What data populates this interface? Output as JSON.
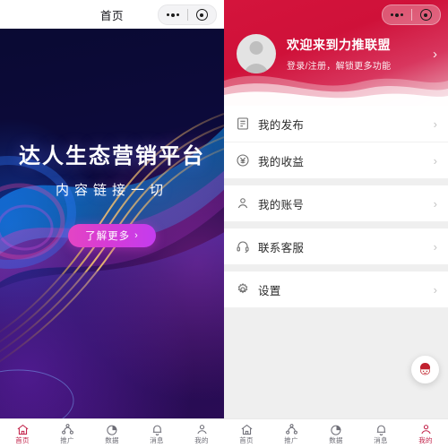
{
  "left_screen": {
    "nav": {
      "title": "首页",
      "capsule": {
        "more_icon": "more-dots-icon",
        "target_icon": "target-circle-icon"
      }
    },
    "hero": {
      "title": "达人生态营销平台",
      "subtitle": "内容链接一切",
      "cta_label": "了解更多",
      "cta_chevron": "›"
    },
    "tabbar": {
      "items": [
        {
          "label": "首页",
          "icon": "home-icon",
          "active": true
        },
        {
          "label": "推广",
          "icon": "share-nodes-icon",
          "active": false
        },
        {
          "label": "数据",
          "icon": "pie-chart-icon",
          "active": false
        },
        {
          "label": "消息",
          "icon": "bell-icon",
          "active": false
        },
        {
          "label": "我的",
          "icon": "user-icon",
          "active": false
        }
      ]
    }
  },
  "right_screen": {
    "nav": {
      "capsule": {
        "more_icon": "more-dots-icon",
        "target_icon": "target-circle-icon"
      }
    },
    "header": {
      "title": "欢迎来到力推联盟",
      "subtitle": "登录/注册，解锁更多功能",
      "arrow": "›",
      "avatar": "default-avatar-icon"
    },
    "menu": [
      {
        "label": "我的发布",
        "icon": "document-list-icon",
        "chevron": "›"
      },
      {
        "label": "我的收益",
        "icon": "yuan-circle-icon",
        "chevron": "›"
      },
      {
        "label": "我的账号",
        "icon": "person-icon",
        "chevron": "›"
      },
      {
        "label": "联系客服",
        "icon": "headset-icon",
        "chevron": "›"
      },
      {
        "label": "设置",
        "icon": "gear-icon",
        "chevron": "›"
      }
    ],
    "fab": {
      "icon": "mascot-service-icon"
    },
    "tabbar": {
      "items": [
        {
          "label": "首页",
          "icon": "home-icon",
          "active": false
        },
        {
          "label": "推广",
          "icon": "share-nodes-icon",
          "active": false
        },
        {
          "label": "数据",
          "icon": "pie-chart-icon",
          "active": false
        },
        {
          "label": "消息",
          "icon": "bell-icon",
          "active": false
        },
        {
          "label": "我的",
          "icon": "user-icon",
          "active": true
        }
      ]
    }
  },
  "colors": {
    "brand_red": "#c2234a",
    "header_red": "#d4143c",
    "cta_pink": "#d63bd6",
    "hero_navy": "#0a0a33",
    "page_bg": "#efefef"
  }
}
